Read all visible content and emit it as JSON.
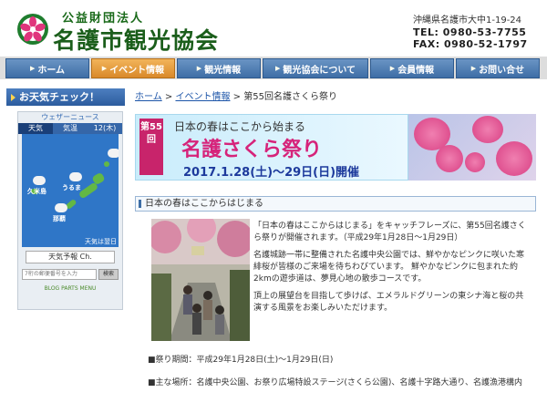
{
  "header": {
    "org_sub": "公益財団法人",
    "org_name": "名護市観光協会",
    "address": "沖縄県名護市大中1-19-24",
    "tel": "TEL: 0980-53-7755",
    "fax": "FAX: 0980-52-1797"
  },
  "nav": [
    {
      "label": "ホーム"
    },
    {
      "label": "イベント情報"
    },
    {
      "label": "観光情報"
    },
    {
      "label": "観光協会について"
    },
    {
      "label": "会員情報"
    },
    {
      "label": "お問い合せ"
    }
  ],
  "sidebar": {
    "title": "お天気チェック！",
    "widget": {
      "header": "ウェザーニュース",
      "tabs": [
        "天気",
        "気温",
        "12(木)"
      ],
      "cities": [
        "久米島",
        "うるま",
        "那覇"
      ],
      "map_footer": "天気は翌日",
      "brand": "天気予報 Ch.",
      "search_placeholder": "7桁の郵便番号を入力",
      "search_button": "検索",
      "menu": "BLOG PARTS MENU"
    }
  },
  "breadcrumb": {
    "home": "ホーム",
    "sep": ">",
    "event": "イベント情報",
    "current": "第55回名護さくら祭り"
  },
  "banner": {
    "num": "第55回",
    "lead": "日本の春はここから始まる",
    "title": "名護さくら祭り",
    "date": "2017.1.28(土)〜29日(日)開催"
  },
  "section_title": "日本の春はここからはじまる",
  "body": {
    "p1": "「日本の春はここからはじまる」をキャッチフレーズに、第55回名護さくら祭りが開催されます。（平成29年1月28日〜1月29日）",
    "p2": "名護城跡一帯に整備された名護中央公園では、鮮やかなピンクに咲いた寒緋桜が皆様のご来場を待ちわびています。 鮮やかなピンクに包まれた約2kmの遊歩道は、夢見心地の散歩コースです。",
    "p3": "頂上の展望台を目指して歩けば、エメラルドグリーンの東シナ海と桜の共演する風景をお楽しみいただけます。"
  },
  "details": {
    "period_label": "■祭り期間：",
    "period": "平成29年1月28日(土)〜1月29日(日)",
    "place_label": "■主な場所：",
    "place": "名護中央公園、お祭り広場特設ステージ(さくら公園)、名護十字路大通り、名護漁港構内"
  },
  "colors": {
    "brand_green": "#1b5e1b",
    "nav_blue": "#3e6ea6",
    "nav_active": "#d9892a",
    "accent_pink": "#d6237a"
  }
}
